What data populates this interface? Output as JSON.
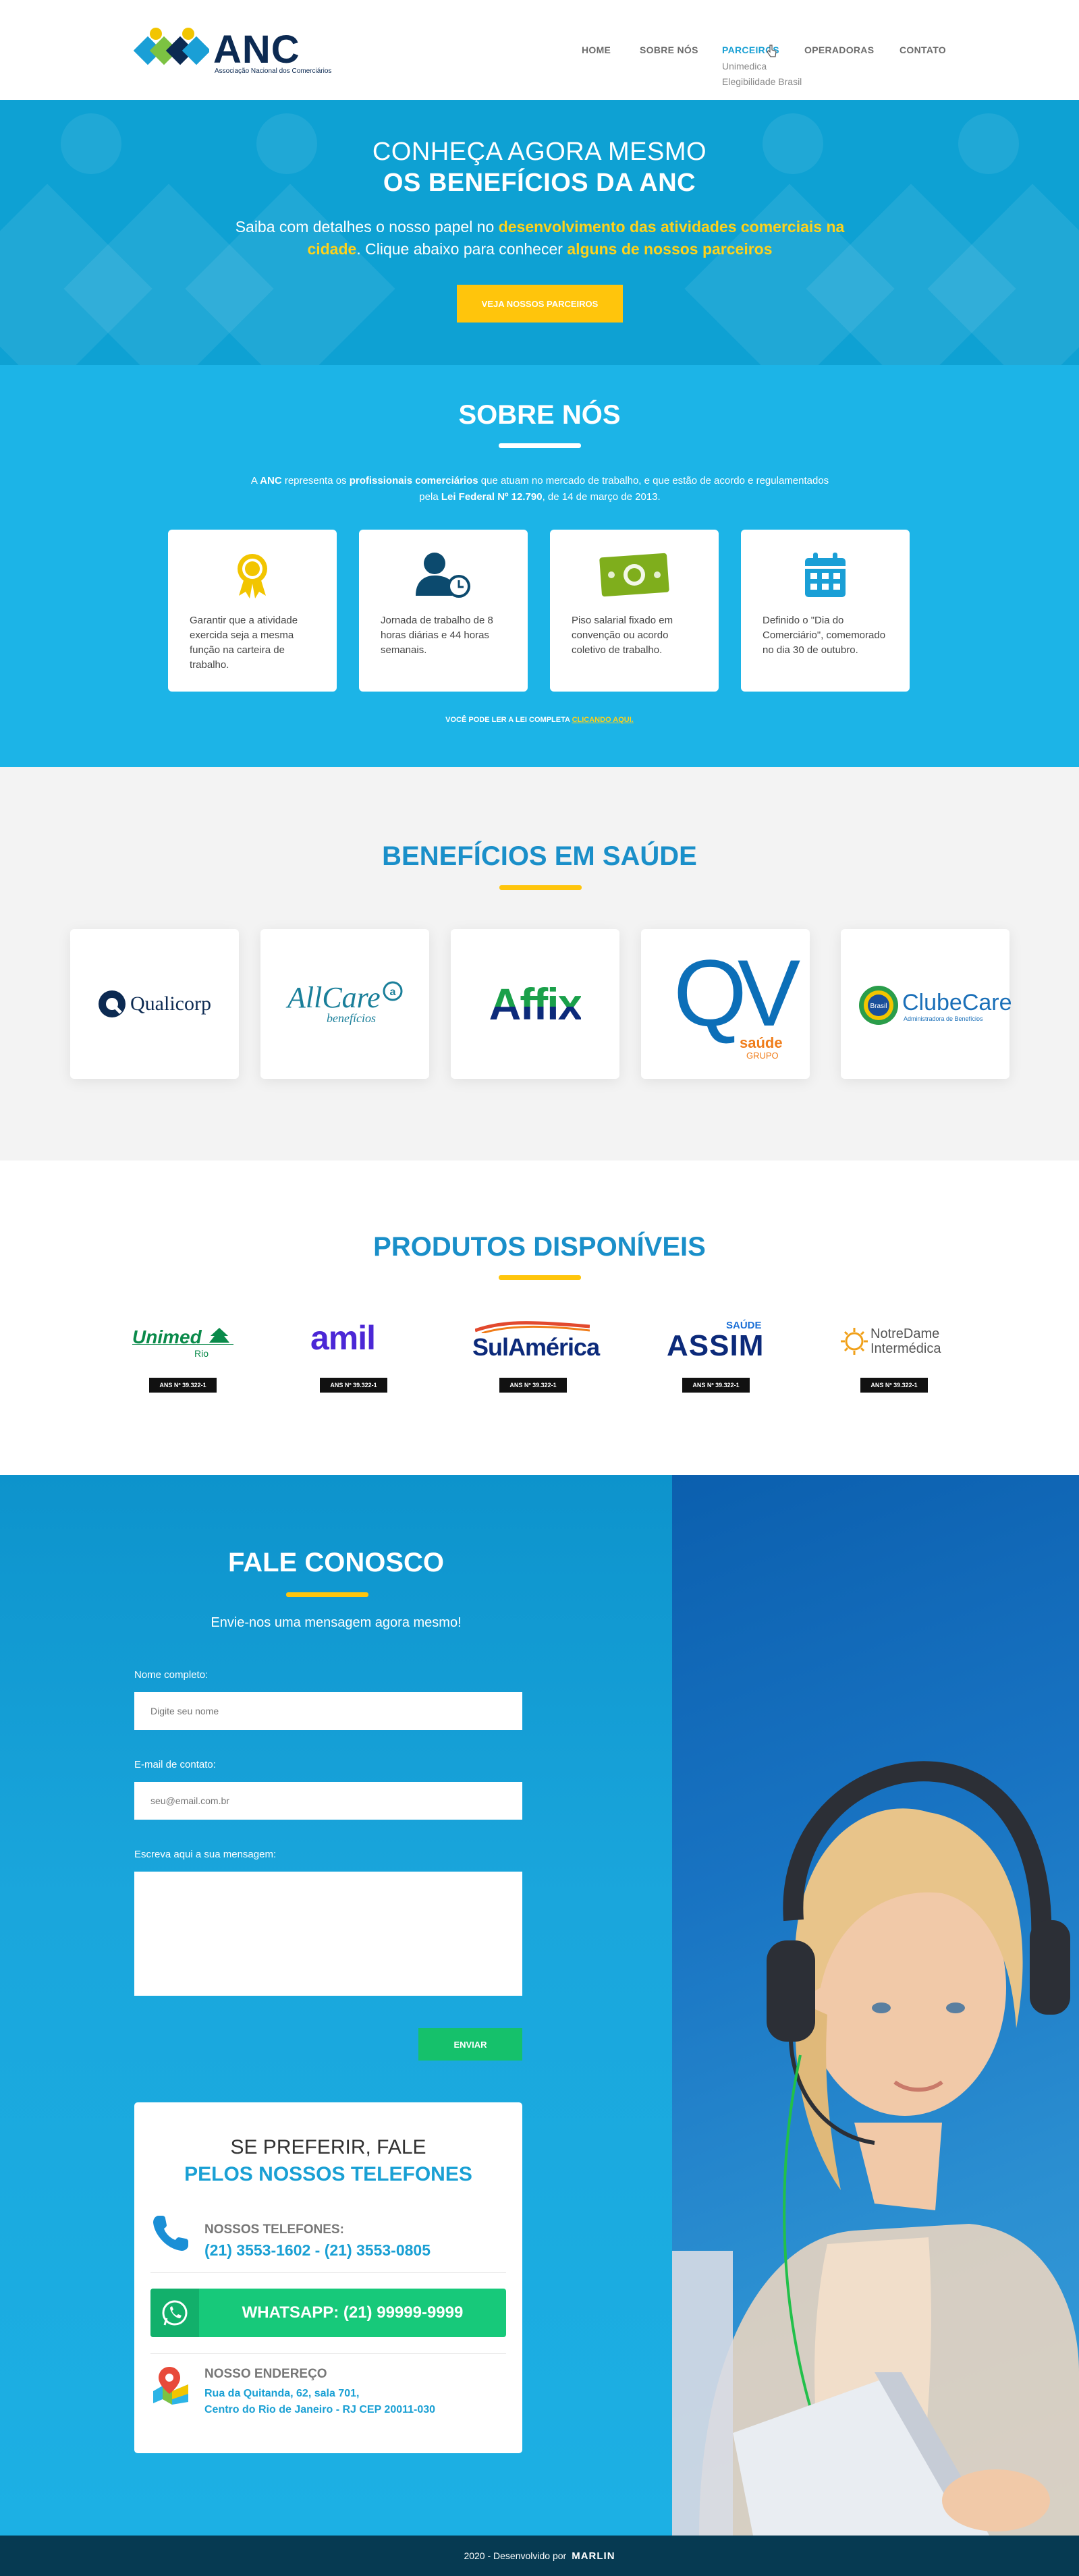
{
  "header": {
    "logo_title": "ANC",
    "logo_subtitle": "Associação Nacional dos Comerciários",
    "nav": [
      {
        "label": "HOME"
      },
      {
        "label": "SOBRE NÓS"
      },
      {
        "label": "PARCEIROS"
      },
      {
        "label": "OPERADORAS"
      },
      {
        "label": "CONTATO"
      }
    ],
    "dropdown": [
      "Unimedica",
      "Elegibilidade Brasil"
    ]
  },
  "hero": {
    "line1": "CONHEÇA AGORA MESMO",
    "line2": "OS BENEFÍCIOS DA ANC",
    "desc_a": "Saiba com detalhes o nosso papel no ",
    "desc_b": "desenvolvimento das atividades comerciais na cidade",
    "desc_c": ". Clique abaixo para conhecer ",
    "desc_d": "alguns de nossos parceiros",
    "button": "VEJA NOSSOS PARCEIROS"
  },
  "about": {
    "title": "SOBRE NÓS",
    "desc_1": "A ",
    "desc_2": "ANC",
    "desc_3": " representa os ",
    "desc_4": "profissionais comerciários",
    "desc_5": " que atuam no mercado de trabalho, e que estão de acordo e regulamentados pela ",
    "desc_6": "Lei Federal Nº 12.790",
    "desc_7": ", de 14 de março de 2013.",
    "cards": [
      {
        "text": "Garantir que a atividade exercida seja a mesma função na carteira de trabalho."
      },
      {
        "text": "Jornada de trabalho de 8 horas diárias e 44 horas semanais."
      },
      {
        "text": "Piso salarial fixado em convenção ou acordo coletivo de trabalho."
      },
      {
        "text": "Definido o \"Dia do Comerciário\", comemorado no dia 30 de outubro."
      }
    ],
    "foot_a": "VOCÊ PODE LER A LEI COMPLETA ",
    "foot_link": "CLICANDO AQUI."
  },
  "benefits": {
    "title": "BENEFÍCIOS EM SAÚDE",
    "logos": [
      {
        "name": "Qualicorp"
      },
      {
        "name": "AllCare",
        "sub": "benefícios"
      },
      {
        "name": "Affix"
      },
      {
        "name": "QV",
        "sub1": "saúde",
        "sub2": "GRUPO"
      },
      {
        "name": "ClubeCare",
        "sub": "Administradora de Benefícios",
        "badge": "Brasil"
      }
    ]
  },
  "products": {
    "title": "PRODUTOS DISPONÍVEIS",
    "items": [
      {
        "name": "Unimed",
        "sub": "Rio",
        "ans": "ANS Nº 39.322-1"
      },
      {
        "name": "amil",
        "ans": "ANS Nº 39.322-1"
      },
      {
        "name": "SulAmérica",
        "ans": "ANS Nº 39.322-1"
      },
      {
        "name": "ASSIM",
        "sub": "SAÚDE",
        "ans": "ANS Nº 39.322-1"
      },
      {
        "name": "NotreDame",
        "sub": "Intermédica",
        "ans": "ANS Nº 39.322-1"
      }
    ]
  },
  "contact": {
    "title": "FALE CONOSCO",
    "subtitle": "Envie-nos uma mensagem agora mesmo!",
    "name_label": "Nome completo:",
    "name_placeholder": "Digite seu nome",
    "email_label": "E-mail de contato:",
    "email_placeholder": "seu@email.com.br",
    "msg_label": "Escreva aqui a sua mensagem:",
    "send": "ENVIAR",
    "card_title1": "SE PREFERIR, FALE",
    "card_title2": "PELOS NOSSOS TELEFONES",
    "phones_label": "NOSSOS TELEFONES:",
    "phones": "(21) 3553-1602 - (21) 3553-0805",
    "whatsapp": "WHATSAPP: (21) 99999-9999",
    "address_label": "NOSSO ENDEREÇO",
    "address_1": "Rua da Quitanda, 62, sala 701,",
    "address_2": "Centro do Rio de Janeiro - RJ CEP 20011-030"
  },
  "footer": {
    "text": "2020 - Desenvolvido por",
    "brand": "MARLIN"
  },
  "colors": {
    "brand_blue": "#1aa0d4",
    "hero_bg": "#0ea1d3",
    "about_bg": "#1cb4e7",
    "accent_yellow": "#ffc50c",
    "green": "#15c16b",
    "footer_bg": "#063a52"
  }
}
